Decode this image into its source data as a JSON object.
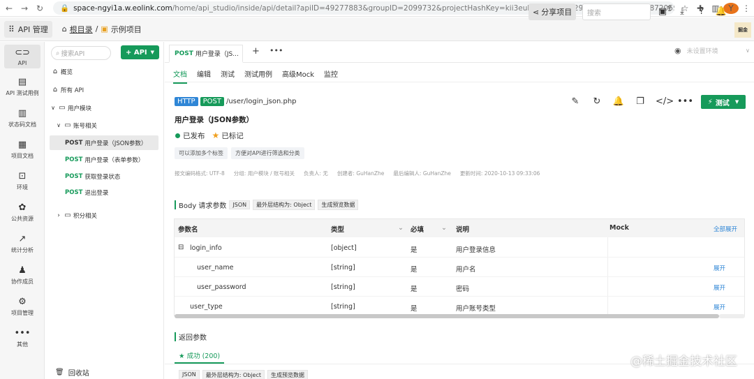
{
  "browser": {
    "url_host": "space-ngyi1a.w.eolink.com",
    "url_path": "/home/api_studio/inside/api/detail?apiID=49277883&groupID=2099732&projectHashKey=kii3euhbdb2081e129d6f38760c37ec51872065394b0fdb...",
    "avatar_letter": "Y"
  },
  "header": {
    "app_label": "API 管理",
    "root": "根目录",
    "separator": "/",
    "project": "示例项目",
    "share": "分享项目",
    "search_placeholder": "搜索",
    "logo_text": "掘金"
  },
  "rail": [
    {
      "icon": "link-icon",
      "label": "API"
    },
    {
      "icon": "test-case-icon",
      "label": "API 测试用例"
    },
    {
      "icon": "status-code-icon",
      "label": "状态码文档"
    },
    {
      "icon": "project-doc-icon",
      "label": "项目文档"
    },
    {
      "icon": "env-icon",
      "label": "环境"
    },
    {
      "icon": "resource-icon",
      "label": "公共资源"
    },
    {
      "icon": "stats-icon",
      "label": "统计分析"
    },
    {
      "icon": "members-icon",
      "label": "协作成员"
    },
    {
      "icon": "settings-icon",
      "label": "项目管理"
    },
    {
      "icon": "more-icon",
      "label": "其他"
    }
  ],
  "tree": {
    "search_placeholder": "搜索API",
    "add_label": "+ API",
    "items": [
      {
        "label": "概览"
      },
      {
        "label": "所有 API"
      },
      {
        "label": "用户模块"
      },
      {
        "label": "账号相关"
      },
      {
        "method": "POST",
        "label": "用户登录（JSON参数）"
      },
      {
        "method": "POST",
        "label": "用户登录（表单参数）"
      },
      {
        "method": "POST",
        "label": "获取登录状态"
      },
      {
        "method": "POST",
        "label": "退出登录"
      },
      {
        "label": "积分相关"
      }
    ],
    "recycle": "回收站"
  },
  "tabbar": {
    "tab_method": "POST",
    "tab_label": "用户登录（JS...",
    "env": "未设置环境"
  },
  "subtabs": [
    "文档",
    "编辑",
    "测试",
    "测试用例",
    "高级Mock",
    "监控"
  ],
  "api": {
    "protocol": "HTTP",
    "method": "POST",
    "path": "/user/login_json.php",
    "title": "用户登录（JSON参数）",
    "status": "已发布",
    "marked": "已标记",
    "tags": [
      "可以添加多个标签",
      "方便对API进行筛选和分类"
    ],
    "meta": {
      "encoding": "报文编码格式: UTF-8",
      "group": "分组: 用户模块 / 账号相关",
      "owner": "负责人: 无",
      "creator": "创建者: GuHanZhe",
      "editor": "最后编辑人: GuHanZhe",
      "updated": "更新时间: 2020-10-13 09:33:06"
    },
    "test_button": "测试"
  },
  "body": {
    "title": "Body 请求参数",
    "format": "JSON",
    "structure": "最外层结构为: Object",
    "preview": "生成预览数据",
    "columns": [
      "参数名",
      "类型",
      "必填",
      "说明",
      "Mock"
    ],
    "expand_all": "全部展开",
    "rows": [
      {
        "name": "login_info",
        "type": "[object]",
        "required": "是",
        "desc": "用户登录信息",
        "action": ""
      },
      {
        "name": "user_name",
        "type": "[string]",
        "required": "是",
        "desc": "用户名",
        "action": "展开"
      },
      {
        "name": "user_password",
        "type": "[string]",
        "required": "是",
        "desc": "密码",
        "action": "展开"
      },
      {
        "name": "user_type",
        "type": "[string]",
        "required": "是",
        "desc": "用户账号类型",
        "action": "展开"
      }
    ]
  },
  "response": {
    "title": "返回参数",
    "success_tab": "成功 (200)",
    "format": "JSON",
    "structure": "最外层结构为: Object",
    "preview": "生成预览数据"
  },
  "watermark": "@稀土掘金技术社区"
}
